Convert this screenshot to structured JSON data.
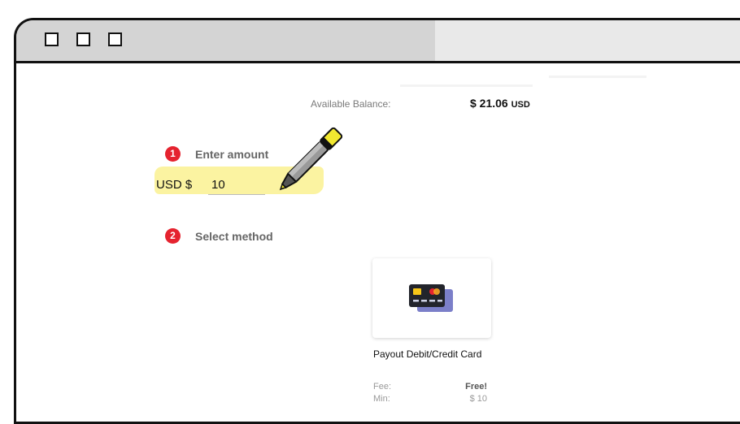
{
  "window": {
    "controls": [
      "window-control",
      "window-control",
      "window-control"
    ]
  },
  "balance": {
    "label": "Available Balance:",
    "amount": "$ 21.06",
    "currency": "USD"
  },
  "steps": [
    {
      "number": "1",
      "label": "Enter amount"
    },
    {
      "number": "2",
      "label": "Select method"
    }
  ],
  "amount": {
    "prefix": "USD $",
    "value": "10"
  },
  "method": {
    "name": "Payout Debit/Credit Card",
    "icon": "credit-card-icon",
    "fee_label": "Fee:",
    "fee_value": "Free!",
    "min_label": "Min:",
    "min_value": "$ 10"
  },
  "overlay": {
    "icon": "highlighter-pen-icon",
    "highlight_color": "#fbf29c",
    "accent": "#e5232f"
  }
}
